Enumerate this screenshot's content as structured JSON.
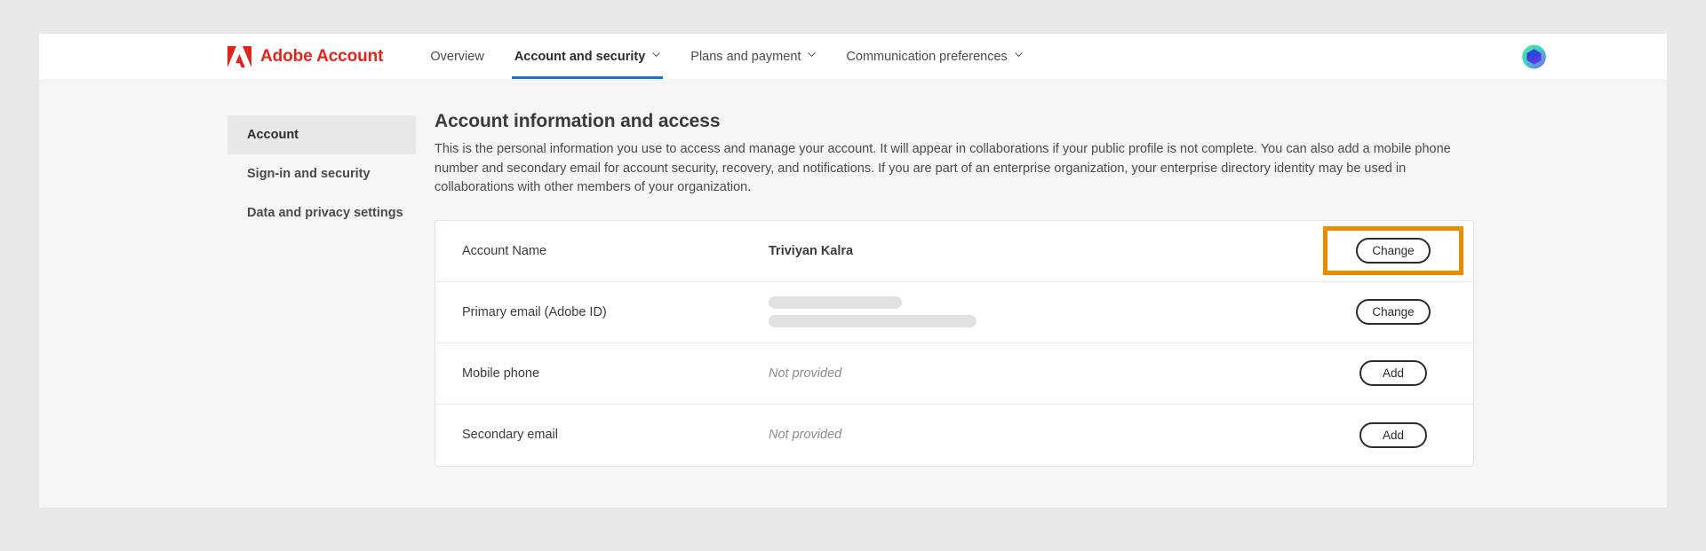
{
  "colors": {
    "adobe_red": "#e1251b",
    "accent_blue": "#1473e6",
    "highlight_orange": "#ed8b00",
    "page_bg": "#f5f5f5",
    "card_bg": "#ffffff",
    "sidebar_selected_bg": "#e8e8e8"
  },
  "topnav": {
    "logo_icon": "adobe-logo-icon",
    "brand": "Adobe Account",
    "items": [
      {
        "label": "Overview",
        "has_caret": false,
        "active": false
      },
      {
        "label": "Account and security",
        "has_caret": true,
        "active": true
      },
      {
        "label": "Plans and payment",
        "has_caret": true,
        "active": false
      },
      {
        "label": "Communication preferences",
        "has_caret": true,
        "active": false
      }
    ],
    "avatar_icon": "user-avatar-icon"
  },
  "sidebar": {
    "items": [
      {
        "label": "Account",
        "selected": true
      },
      {
        "label": "Sign-in and security",
        "selected": false
      },
      {
        "label": "Data and privacy settings",
        "selected": false
      }
    ]
  },
  "main": {
    "title": "Account information and access",
    "description": "This is the personal information you use to access and manage your account. It will appear in collaborations if your public profile is not complete. You can also add a mobile phone number and secondary email for account security, recovery, and notifications. If you are part of an enterprise organization, your enterprise directory identity may be used in collaborations with other members of your organization.",
    "rows": [
      {
        "label": "Account Name",
        "value": "Triviyan Kalra",
        "value_style": "bold",
        "action": "Change",
        "highlighted": true
      },
      {
        "label": "Primary email (Adobe ID)",
        "value": "",
        "value_style": "redacted",
        "action": "Change",
        "highlighted": false
      },
      {
        "label": "Mobile phone",
        "value": "Not provided",
        "value_style": "muted",
        "action": "Add",
        "highlighted": false
      },
      {
        "label": "Secondary email",
        "value": "Not provided",
        "value_style": "muted",
        "action": "Add",
        "highlighted": false
      }
    ]
  }
}
